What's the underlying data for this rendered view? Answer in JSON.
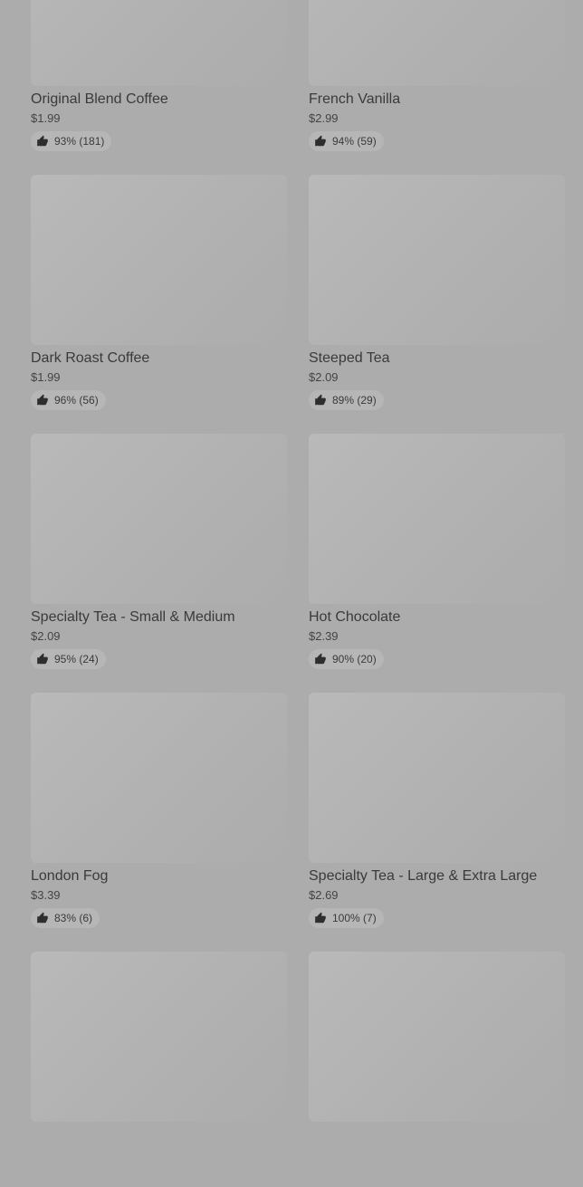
{
  "items": [
    {
      "name": "Original Blend Coffee",
      "price": "$1.99",
      "rating": "93% (181)"
    },
    {
      "name": "French Vanilla",
      "price": "$2.99",
      "rating": "94% (59)"
    },
    {
      "name": "Dark Roast Coffee",
      "price": "$1.99",
      "rating": "96% (56)"
    },
    {
      "name": "Steeped Tea",
      "price": "$2.09",
      "rating": "89% (29)"
    },
    {
      "name": "Specialty Tea - Small & Medium",
      "price": "$2.09",
      "rating": "95% (24)"
    },
    {
      "name": "Hot Chocolate",
      "price": "$2.39",
      "rating": "90% (20)"
    },
    {
      "name": "London Fog",
      "price": "$3.39",
      "rating": "83% (6)"
    },
    {
      "name": "Specialty Tea - Large & Extra Large",
      "price": "$2.69",
      "rating": "100% (7)"
    }
  ],
  "icons": {
    "rating": "thumbs-up-icon"
  },
  "colors": {
    "background": "#acacac",
    "text": "#3c3c3c",
    "rating_pill": "#b6b6b6"
  }
}
